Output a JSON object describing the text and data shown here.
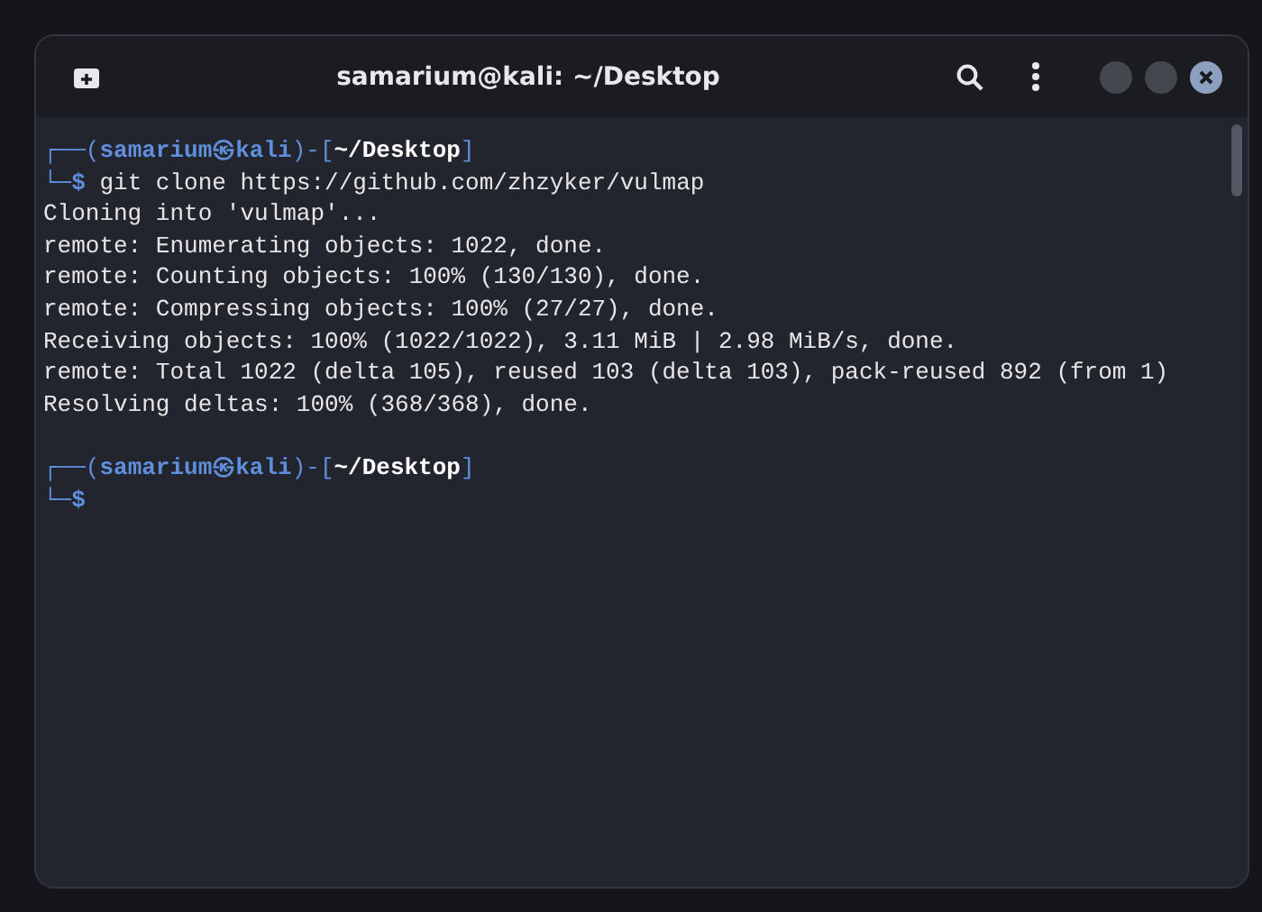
{
  "window": {
    "title": "samarium@kali: ~/Desktop"
  },
  "terminal": {
    "lines": [
      {
        "kind": "prompt",
        "open": "┌──(",
        "user": "samarium",
        "symbol": "㉿",
        "host": "kali",
        "mid": ")-[",
        "path": "~/Desktop",
        "close": "]",
        "corner": "└─",
        "sigil": "$",
        "command": "git clone https://github.com/zhzyker/vulmap"
      },
      {
        "kind": "output",
        "text": "Cloning into 'vulmap'..."
      },
      {
        "kind": "output",
        "text": "remote: Enumerating objects: 1022, done."
      },
      {
        "kind": "output",
        "text": "remote: Counting objects: 100% (130/130), done."
      },
      {
        "kind": "output",
        "text": "remote: Compressing objects: 100% (27/27), done."
      },
      {
        "kind": "output",
        "text": "Receiving objects: 100% (1022/1022), 3.11 MiB | 2.98 MiB/s, done."
      },
      {
        "kind": "output",
        "text": "remote: Total 1022 (delta 105), reused 103 (delta 103), pack-reused 892 (from 1)"
      },
      {
        "kind": "output",
        "text": "Resolving deltas: 100% (368/368), done."
      },
      {
        "kind": "blank"
      },
      {
        "kind": "prompt",
        "open": "┌──(",
        "user": "samarium",
        "symbol": "㉿",
        "host": "kali",
        "mid": ")-[",
        "path": "~/Desktop",
        "close": "]",
        "corner": "└─",
        "sigil": "$"
      }
    ]
  }
}
